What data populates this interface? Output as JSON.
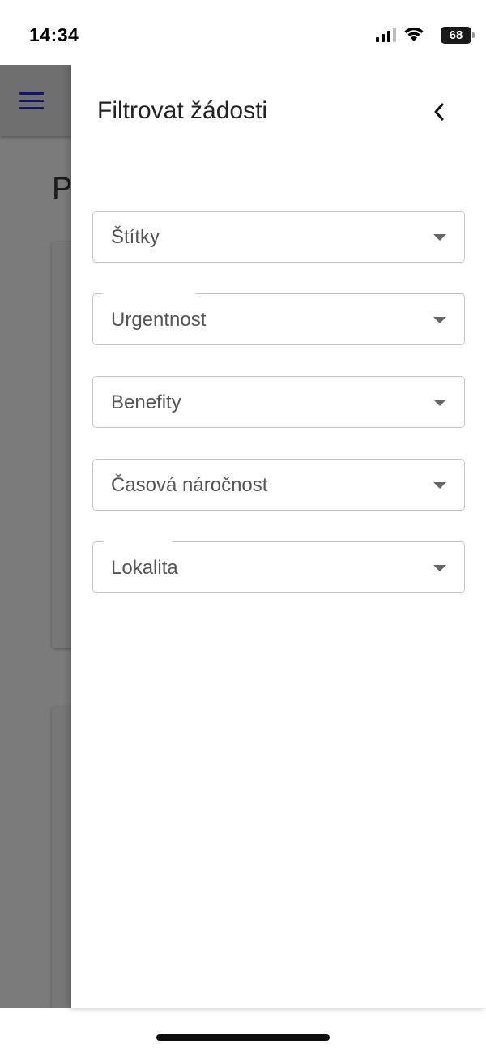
{
  "status_bar": {
    "time": "14:34",
    "battery": "68",
    "icons": [
      "signal-icon",
      "wifi-icon",
      "battery-icon"
    ]
  },
  "background_app": {
    "page_title_fragment": "P",
    "menu_icon": "menu-icon",
    "overlay_color": "#7b7b7b"
  },
  "drawer": {
    "title": "Filtrovat žádosti",
    "back_icon": "chevron-left-icon",
    "filters": [
      {
        "label": "Štítky"
      },
      {
        "label": "Urgentnost"
      },
      {
        "label": "Benefity"
      },
      {
        "label": "Časová náročnost"
      },
      {
        "label": "Lokalita"
      }
    ]
  },
  "colors": {
    "menu_icon": "#14146e",
    "field_border": "#c4c4c4",
    "field_label": "#555555"
  }
}
